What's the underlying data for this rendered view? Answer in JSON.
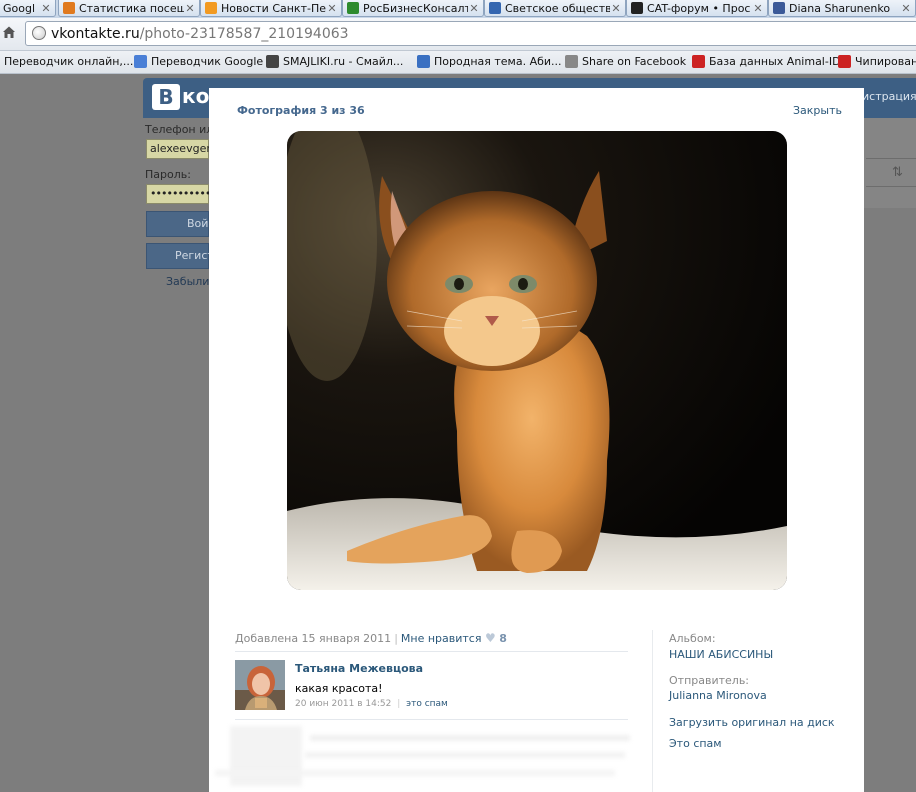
{
  "browser": {
    "tabs": [
      {
        "label": "Googl",
        "icon": "google-icon",
        "color": "#4a7fd6"
      },
      {
        "label": "Статистика посещ",
        "icon": "fox-icon",
        "color": "#e07a1f"
      },
      {
        "label": "Новости Санкт-Пе",
        "icon": "news-icon",
        "color": "#f29a22"
      },
      {
        "label": "РосБизнесКонсалт",
        "icon": "rbc-icon",
        "color": "#2e8b2e"
      },
      {
        "label": "Светское обществ",
        "icon": "nl-icon",
        "color": "#3466b0"
      },
      {
        "label": "CAT-форум • Прос",
        "icon": "cat-icon",
        "color": "#222222"
      },
      {
        "label": "Diana Sharunenko",
        "icon": "facebook-icon",
        "color": "#3b5998"
      }
    ],
    "close_glyph": "✕",
    "url_host": "vkontakte.ru",
    "url_path": "/photo-23178587_210194063",
    "bookmarks": [
      {
        "label": "Переводчик онлайн,...",
        "icon": "translate-icon",
        "color": "#ffffff"
      },
      {
        "label": "Переводчик Google",
        "icon": "google-translate-icon",
        "color": "#4a7fd6"
      },
      {
        "label": "SMAJLIKI.ru - Смайл...",
        "icon": "smile-icon",
        "color": "#444444"
      },
      {
        "label": "Породная тема. Аби...",
        "icon": "forum-icon",
        "color": "#3a70c2"
      },
      {
        "label": "Share on Facebook",
        "icon": "globe-icon",
        "color": "#888888"
      },
      {
        "label": "База данных Animal-ID",
        "icon": "paw-icon",
        "color": "#cc2222"
      },
      {
        "label": "Чипирование",
        "icon": "paw-icon",
        "color": "#cc2222"
      }
    ]
  },
  "vk": {
    "logo_letter": "В",
    "logo_text": "кон",
    "header_right": "истрация",
    "phone_label": "Телефон или",
    "phone_value": "alexeevgen",
    "password_label": "Пароль:",
    "password_value": "••••••••••••",
    "login_button": "Вой",
    "register_button": "Регист",
    "forgot_link": "Забыли п",
    "sort_glyph": "⇅"
  },
  "viewer": {
    "title": "Фотография 3 из 36",
    "close": "Закрыть",
    "added": "Добавлена 15 января 2011",
    "like": "Мне нравится",
    "like_count": "8",
    "comment": {
      "author": "Татьяна Межевцова",
      "text": "какая красота!",
      "date": "20 июн 2011 в 14:52",
      "spam": "это спам"
    },
    "album_label": "Альбом:",
    "album_value": "НАШИ АБИССИНЫ",
    "sender_label": "Отправитель:",
    "sender_value": "Julianna Mironova",
    "download": "Загрузить оригинал на диск",
    "spam": "Это спам"
  }
}
